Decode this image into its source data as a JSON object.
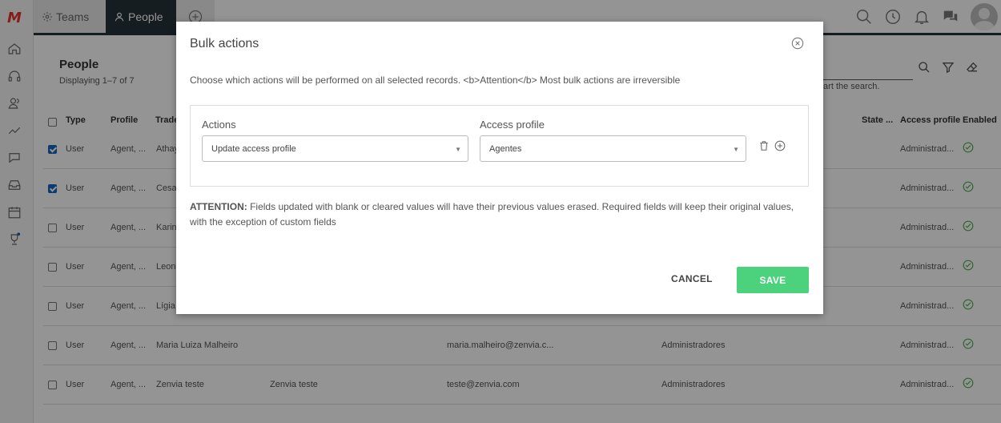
{
  "app": {
    "logo": "M"
  },
  "tabs": [
    {
      "label": "Teams"
    },
    {
      "label": "People"
    }
  ],
  "page": {
    "title": "People",
    "subtitle": "Displaying 1–7 of 7",
    "search_hint": "tart the search."
  },
  "table": {
    "headers": [
      "Type",
      "Profile",
      "Trade",
      "State ...",
      "Access profile",
      "Enabled"
    ],
    "rows": [
      {
        "checked": true,
        "type": "User",
        "profile": "Agent, ...",
        "name": "Athay",
        "trade": "",
        "email": "",
        "group": "",
        "access": "Administrad..."
      },
      {
        "checked": true,
        "type": "User",
        "profile": "Agent, ...",
        "name": "Cesa",
        "trade": "",
        "email": "",
        "group": "",
        "access": "Administrad..."
      },
      {
        "checked": false,
        "type": "User",
        "profile": "Agent, ...",
        "name": "Karin",
        "trade": "",
        "email": "",
        "group": "",
        "access": "Administrad..."
      },
      {
        "checked": false,
        "type": "User",
        "profile": "Agent, ...",
        "name": "Leon",
        "trade": "",
        "email": "",
        "group": "",
        "access": "Administrad..."
      },
      {
        "checked": false,
        "type": "User",
        "profile": "Agent, ...",
        "name": "Lígia",
        "trade": "",
        "email": "",
        "group": "",
        "access": "Administrad..."
      },
      {
        "checked": false,
        "type": "User",
        "profile": "Agent, ...",
        "name": "Maria Luiza Malheiro",
        "trade": "",
        "email": "maria.malheiro@zenvia.c...",
        "group": "Administradores",
        "access": "Administrad..."
      },
      {
        "checked": false,
        "type": "User",
        "profile": "Agent, ...",
        "name": "Zenvia teste",
        "trade": "Zenvia teste",
        "email": "teste@zenvia.com",
        "group": "Administradores",
        "access": "Administrad..."
      }
    ]
  },
  "modal": {
    "title": "Bulk actions",
    "description": "Choose which actions will be performed on all selected records. <b>Attention</b> Most bulk actions are irreversible",
    "actions_label": "Actions",
    "actions_value": "Update access profile",
    "access_label": "Access profile",
    "access_value": "Agentes",
    "attention_bold": "ATTENTION:",
    "attention_text": " Fields updated with blank or cleared values will have their previous values erased. Required fields will keep their original values, with the exception of custom fields",
    "cancel_label": "CANCEL",
    "save_label": "SAVE"
  },
  "colors": {
    "accent": "#263238",
    "save": "#4cd17c",
    "check": "#1565c0",
    "enabled": "#4caf50"
  }
}
